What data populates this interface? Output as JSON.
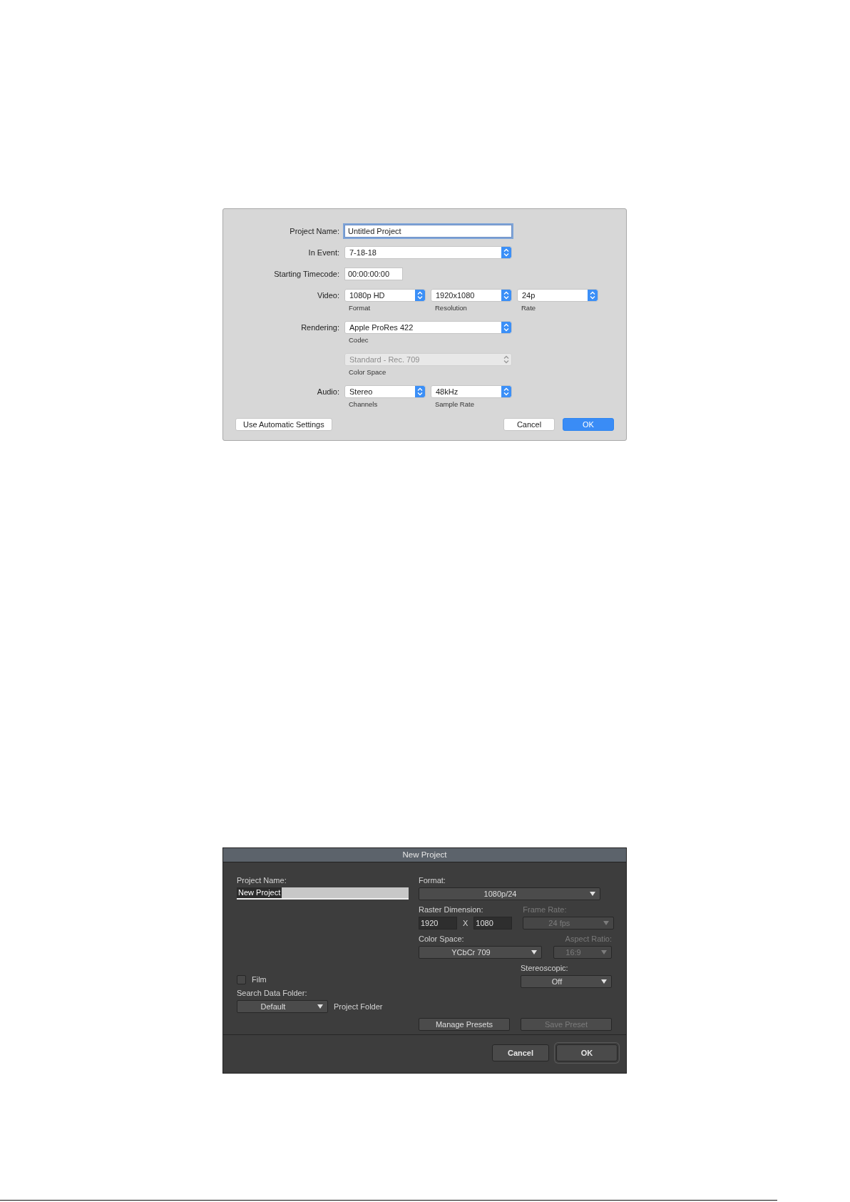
{
  "dialog_1": {
    "rows": [
      {
        "label": "Project Name:",
        "controls": [
          {
            "kind": "text",
            "value": "Untitled Project",
            "focused": true
          }
        ]
      },
      {
        "label": "In Event:",
        "controls": [
          {
            "kind": "popup",
            "value": "7-18-18"
          }
        ]
      },
      {
        "label": "Starting Timecode:",
        "controls": [
          {
            "kind": "text",
            "value": "00:00:00:00",
            "focused": false
          }
        ]
      },
      {
        "label": "Video:",
        "controls": [
          {
            "kind": "popup",
            "value": "1080p HD",
            "caption": "Format"
          },
          {
            "kind": "popup",
            "value": "1920x1080",
            "caption": "Resolution"
          },
          {
            "kind": "popup",
            "value": "24p",
            "caption": "Rate"
          }
        ]
      },
      {
        "label": "Rendering:",
        "controls": [
          {
            "kind": "popup",
            "value": "Apple ProRes 422",
            "caption": "Codec"
          }
        ]
      },
      {
        "controls": [
          {
            "kind": "popup",
            "value": "Standard - Rec. 709",
            "caption": "Color Space",
            "disabled": true
          }
        ]
      },
      {
        "label": "Audio:",
        "controls": [
          {
            "kind": "popup",
            "value": "Stereo",
            "caption": "Channels"
          },
          {
            "kind": "popup",
            "value": "48kHz",
            "caption": "Sample Rate"
          }
        ]
      }
    ],
    "buttons": [
      {
        "label": "Use Automatic Settings",
        "default": false
      },
      {
        "label": "Cancel",
        "default": false
      },
      {
        "label": "OK",
        "default": true
      }
    ]
  },
  "dialog_2": {
    "title": "New Project",
    "project_name": {
      "label": "Project Name:",
      "value": "New Project"
    },
    "format": {
      "label": "Format:",
      "value": "1080p/24"
    },
    "raster_dimension": {
      "label": "Raster Dimension:",
      "values": [
        "1920",
        "1080"
      ],
      "separator": "X"
    },
    "frame_rate": {
      "label": "Frame Rate:",
      "value": "24 fps",
      "disabled": true
    },
    "color_space": {
      "label": "Color Space:",
      "value": "YCbCr 709"
    },
    "aspect_ratio": {
      "label": "Aspect Ratio:",
      "value": "16:9",
      "disabled": true
    },
    "stereoscopic": {
      "label": "Stereoscopic:",
      "value": "Off"
    },
    "film": {
      "label": "Film",
      "checked": false
    },
    "search_data_folder": {
      "label": "Search Data Folder:",
      "value": "Default",
      "note": "Project Folder"
    },
    "preset_buttons": [
      {
        "label": "Manage Presets",
        "disabled": false
      },
      {
        "label": "Save Preset",
        "disabled": true
      }
    ],
    "buttons": [
      {
        "label": "Cancel",
        "default": false
      },
      {
        "label": "OK",
        "default": true
      }
    ]
  }
}
